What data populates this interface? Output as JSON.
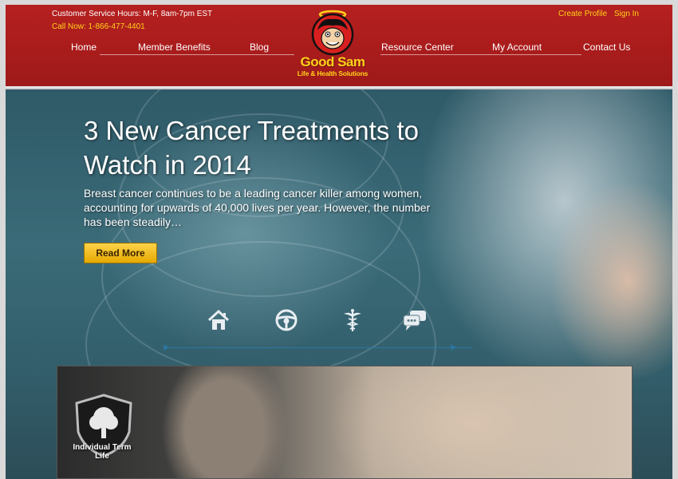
{
  "header": {
    "hours": "Customer Service Hours: M-F, 8am-7pm EST",
    "phone": "Call Now: 1-866-477-4401",
    "create_profile": "Create Profile",
    "sign_in": "Sign In",
    "logo_name": "Good Sam",
    "logo_tagline": "Life & Health Solutions",
    "nav": {
      "home": "Home",
      "member_benefits": "Member Benefits",
      "blog": "Blog",
      "resource_center": "Resource Center",
      "my_account": "My Account",
      "contact_us": "Contact Us"
    }
  },
  "hero": {
    "headline": "3 New Cancer Treatments to Watch in 2014",
    "intro": "Breast cancer continues to be a leading cancer killer among women, accounting for upwards of 40,000 lives per year. However, the number has been steadily…",
    "read_more": "Read More",
    "icons": [
      "home-icon",
      "steering-wheel-icon",
      "caduceus-icon",
      "chat-icon"
    ]
  },
  "feature": {
    "label": "Individual Term Life",
    "icon": "tree-icon"
  },
  "colors": {
    "header_red": "#a81c1c",
    "accent_yellow": "#ffd21a",
    "button_gold": "#e5a900",
    "slider_blue": "#2a77a8"
  }
}
